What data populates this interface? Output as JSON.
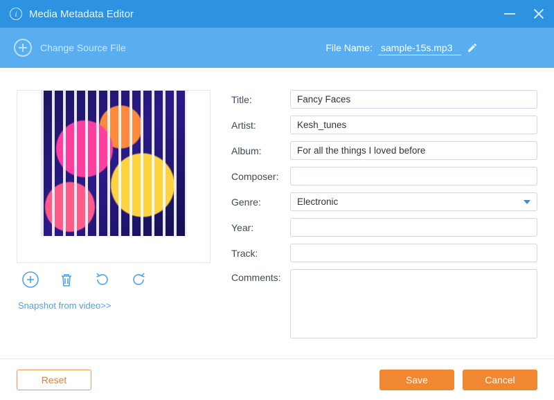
{
  "window": {
    "title": "Media Metadata Editor"
  },
  "toolbar": {
    "change_source_label": "Change Source File",
    "file_name_label": "File Name:",
    "file_name": "sample-15s.mp3"
  },
  "artwork": {
    "snapshot_link": "Snapshot from video>>"
  },
  "form": {
    "labels": {
      "title": "Title:",
      "artist": "Artist:",
      "album": "Album:",
      "composer": "Composer:",
      "genre": "Genre:",
      "year": "Year:",
      "track": "Track:",
      "comments": "Comments:"
    },
    "values": {
      "title": "Fancy Faces",
      "artist": "Kesh_tunes",
      "album": "For all the things I loved before",
      "composer": "",
      "genre": "Electronic",
      "year": "",
      "track": "",
      "comments": ""
    }
  },
  "footer": {
    "reset": "Reset",
    "save": "Save",
    "cancel": "Cancel"
  }
}
